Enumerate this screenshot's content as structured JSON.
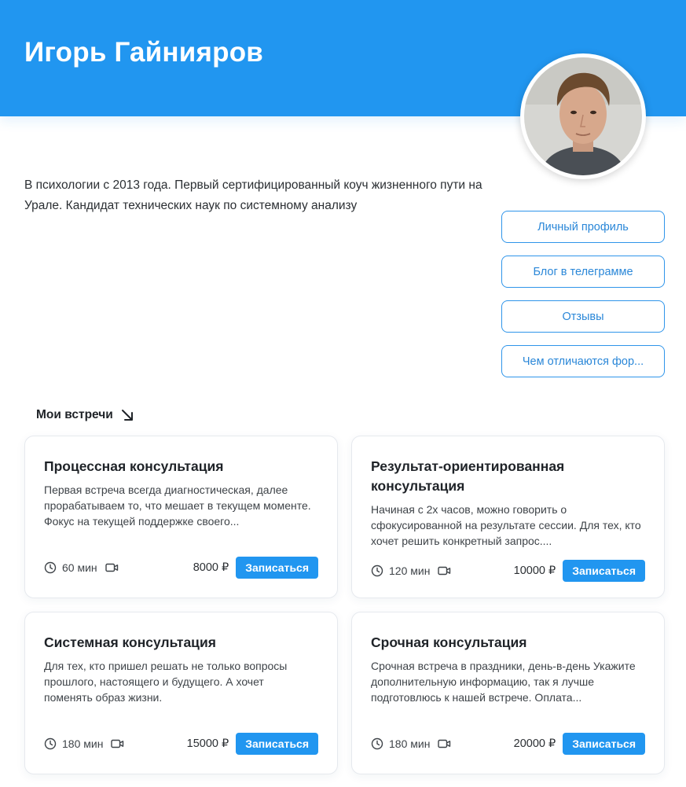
{
  "profile": {
    "name": "Игорь Гайнияров",
    "bio": "В психологии с 2013 года. Первый сертифицированный коуч жизненного пути на Урале. Кандидат технических наук по системному анализу"
  },
  "links": [
    {
      "label": "Личный профиль"
    },
    {
      "label": "Блог в телеграмме"
    },
    {
      "label": "Отзывы"
    },
    {
      "label": "Чем отличаются фор..."
    }
  ],
  "meetings": {
    "section_title": "Мои встречи",
    "section_icon": "arrow-down-right-icon",
    "cards": [
      {
        "title": "Процессная консультация",
        "description": "Первая встреча всегда диагностическая, далее прорабатываем то, что мешает в текущем моменте. Фокус на текущей поддержке своего...",
        "duration": "60 мин",
        "price": "8000 ₽",
        "button": "Записаться"
      },
      {
        "title": "Результат-ориентированная консультация",
        "description": "Начиная с 2х часов, можно говорить о сфокусированной на результате сессии. Для тех, кто хочет решить конкретный запрос....",
        "duration": "120 мин",
        "price": "10000 ₽",
        "button": "Записаться"
      },
      {
        "title": "Системная консультация",
        "description": "Для тех, кто пришел решать не только вопросы прошлого, настоящего и будущего. А хочет поменять образ жизни.",
        "duration": "180 мин",
        "price": "15000 ₽",
        "button": "Записаться"
      },
      {
        "title": "Срочная консультация",
        "description": "Срочная встреча в праздники, день-в-день Укажите дополнительную информацию, так я лучше подготовлюсь к нашей встрече. Оплата...",
        "duration": "180 мин",
        "price": "20000 ₽",
        "button": "Записаться"
      }
    ]
  },
  "colors": {
    "accent": "#2196f0",
    "link_border": "#2f95ea",
    "link_text": "#2a87d8"
  }
}
